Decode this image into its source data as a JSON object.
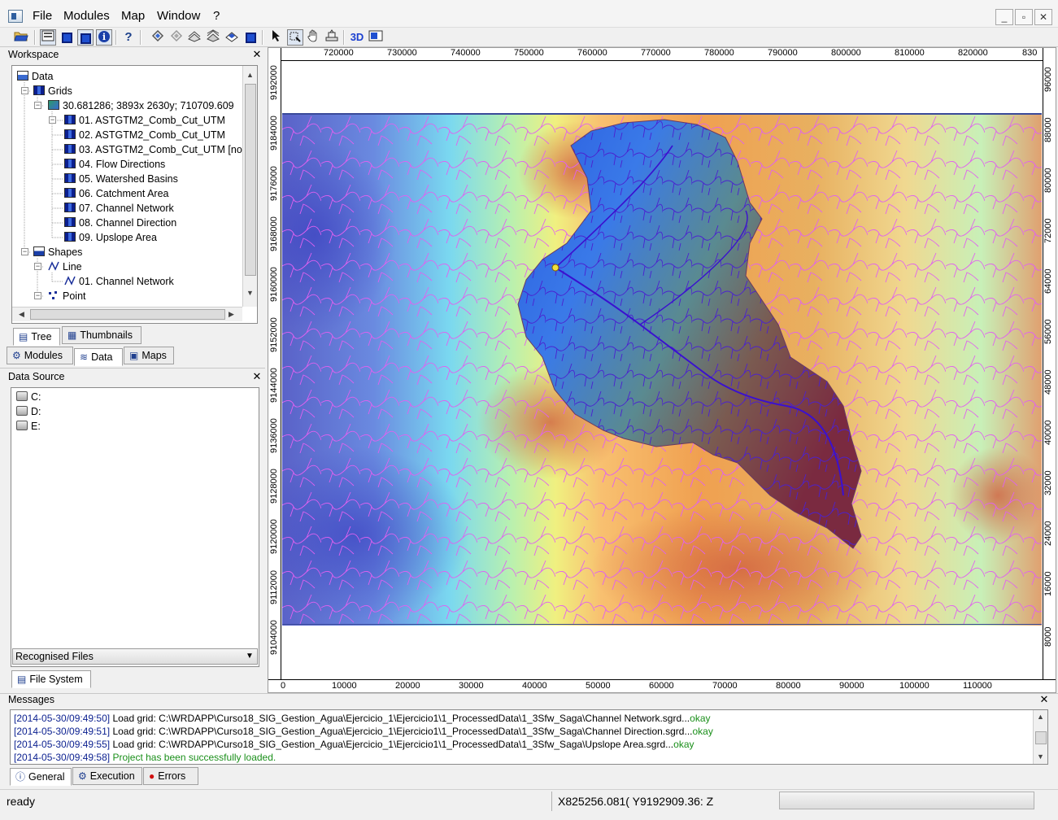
{
  "menubar": {
    "items": [
      "File",
      "Modules",
      "Map",
      "Window",
      "?"
    ],
    "window_buttons": [
      "_",
      "▫",
      "✕"
    ]
  },
  "toolbar": {
    "icons": [
      "open-icon",
      "workspace-icon",
      "object-properties-icon",
      "data-source-icon",
      "info-icon",
      "help-icon",
      "add-layer-icon",
      "remove-layer-icon",
      "print-icon",
      "print-preview-icon",
      "layers-icon",
      "map-icon",
      "select-icon",
      "zoom-icon",
      "pan-icon",
      "distance-icon",
      "3d-view-icon",
      "layout-icon"
    ],
    "label_3d": "3D"
  },
  "workspace": {
    "title": "Workspace",
    "tree": {
      "data": "Data",
      "grids": "Grids",
      "system": "30.681286; 3893x 2630y; 710709.609",
      "grid_items": [
        "01. ASTGTM2_Comb_Cut_UTM",
        "02. ASTGTM2_Comb_Cut_UTM",
        "03. ASTGTM2_Comb_Cut_UTM [no",
        "04. Flow Directions",
        "05. Watershed Basins",
        "06. Catchment Area",
        "07. Channel Network",
        "08. Channel Direction",
        "09. Upslope Area"
      ],
      "shapes": "Shapes",
      "line": "Line",
      "line_item": "01. Channel Network",
      "point": "Point"
    },
    "subtabs": [
      "Tree",
      "Thumbnails"
    ],
    "tabs": [
      "Modules",
      "Data",
      "Maps"
    ]
  },
  "data_source": {
    "title": "Data Source",
    "drives": [
      "C:",
      "D:",
      "E:"
    ],
    "filter": "Recognised Files",
    "tab": "File System"
  },
  "map": {
    "x_top_labels": [
      "720000",
      "730000",
      "740000",
      "750000",
      "760000",
      "770000",
      "780000",
      "790000",
      "800000",
      "810000",
      "820000",
      "830"
    ],
    "x_bottom_labels": [
      "0",
      "10000",
      "20000",
      "30000",
      "40000",
      "50000",
      "60000",
      "70000",
      "80000",
      "90000",
      "100000",
      "110000"
    ],
    "y_left_labels": [
      "9192000",
      "9184000",
      "9176000",
      "9168000",
      "9160000",
      "9152000",
      "9144000",
      "9136000",
      "9128000",
      "9120000",
      "9112000",
      "9104000"
    ],
    "y_right_labels": [
      "96000",
      "88000",
      "80000",
      "72000",
      "64000",
      "56000",
      "48000",
      "40000",
      "32000",
      "24000",
      "16000",
      "8000"
    ]
  },
  "messages": {
    "title": "Messages",
    "lines": [
      {
        "ts": "[2014-05-30/09:49:50]",
        "text": " Load grid: C:\\WRDAPP\\Curso18_SIG_Gestion_Agua\\Ejercicio_1\\Ejercicio1\\1_ProcessedData\\1_3Sfw_Saga\\Channel Network.sgrd...",
        "ok": "okay"
      },
      {
        "ts": "[2014-05-30/09:49:51]",
        "text": " Load grid: C:\\WRDAPP\\Curso18_SIG_Gestion_Agua\\Ejercicio_1\\Ejercicio1\\1_ProcessedData\\1_3Sfw_Saga\\Channel Direction.sgrd...",
        "ok": "okay"
      },
      {
        "ts": "[2014-05-30/09:49:55]",
        "text": " Load grid: C:\\WRDAPP\\Curso18_SIG_Gestion_Agua\\Ejercicio_1\\Ejercicio1\\1_ProcessedData\\1_3Sfw_Saga\\Upslope Area.sgrd...",
        "ok": "okay"
      },
      {
        "ts": "[2014-05-30/09:49:58]",
        "text": "",
        "ok": " Project has been successfully loaded."
      }
    ],
    "tabs": [
      "General",
      "Execution",
      "Errors"
    ]
  },
  "status": {
    "text": "ready",
    "coords": "X825256.081( Y9192909.36: Z"
  },
  "colors": {
    "timestamp": "#0a1f8f",
    "okay": "#1a8f1a",
    "channel_network": "#e060f0",
    "basin_channels": "#4a20d0"
  }
}
